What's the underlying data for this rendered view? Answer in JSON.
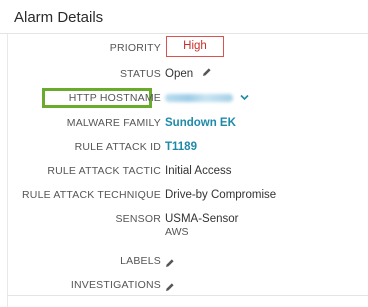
{
  "panel": {
    "title": "Alarm Details"
  },
  "rows": {
    "priority": {
      "label": "PRIORITY",
      "value": "High"
    },
    "status": {
      "label": "STATUS",
      "value": "Open"
    },
    "http_hostname": {
      "label": "HTTP HOSTNAME",
      "value_redacted": true
    },
    "malware_family": {
      "label": "MALWARE FAMILY",
      "value": "Sundown EK"
    },
    "rule_attack_id": {
      "label": "RULE ATTACK ID",
      "value": "T1189"
    },
    "rule_attack_tactic": {
      "label": "RULE ATTACK TACTIC",
      "value": "Initial Access"
    },
    "rule_attack_technique": {
      "label": "RULE ATTACK TECHNIQUE",
      "value": "Drive-by Compromise"
    },
    "sensor": {
      "label": "SENSOR",
      "value": "USMA-Sensor",
      "sub": "AWS"
    },
    "labels": {
      "label": "LABELS"
    },
    "investigations": {
      "label": "INVESTIGATIONS"
    }
  },
  "colors": {
    "link": "#1e8aa9",
    "priority_high": "#d9534f",
    "highlight": "#6aab2e"
  },
  "icons": {
    "edit": "pencil-icon",
    "dropdown": "chevron-down-icon"
  }
}
